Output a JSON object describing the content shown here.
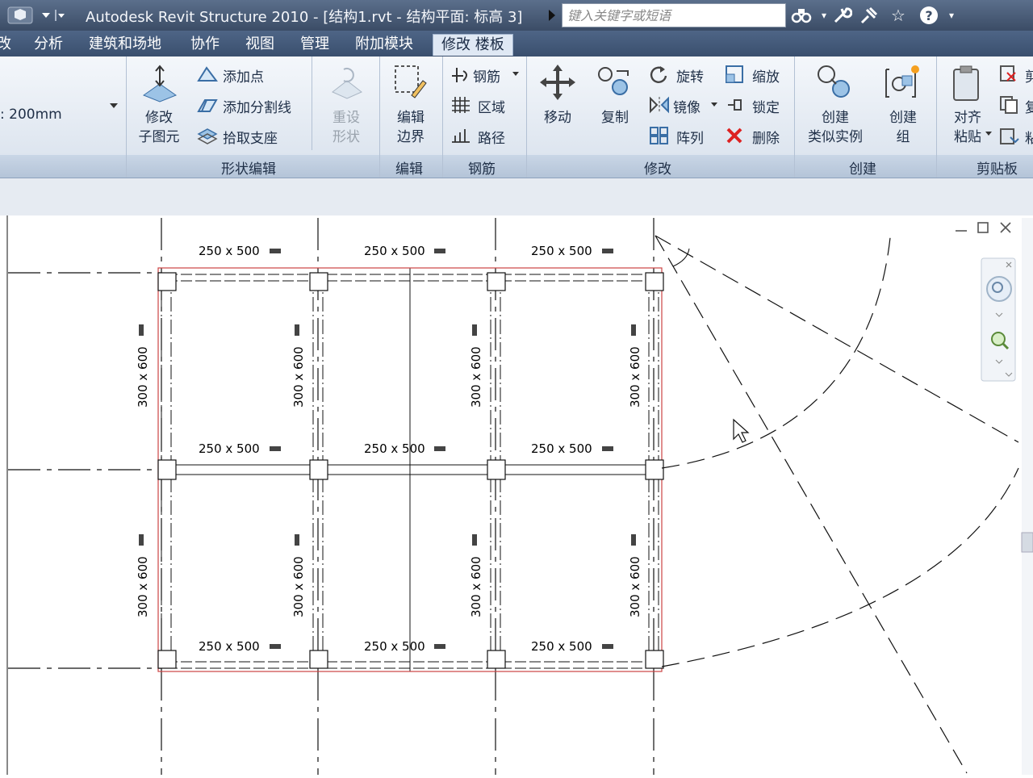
{
  "window": {
    "title": "Autodesk Revit Structure 2010 - [结构1.rvt - 结构平面: 标高 3]",
    "search_placeholder": "键入关键字或短语"
  },
  "tabs": [
    {
      "label": "改"
    },
    {
      "label": "分析"
    },
    {
      "label": "建筑和场地"
    },
    {
      "label": "协作"
    },
    {
      "label": "视图"
    },
    {
      "label": "管理"
    },
    {
      "label": "附加模块"
    },
    {
      "label": "修改 楼板",
      "active": true
    }
  ],
  "properties": {
    "value": "200mm"
  },
  "shape_edit": {
    "modify_sub": "修改\n子图元",
    "add_point": "添加点",
    "add_split_line": "添加分割线",
    "pick_support": "拾取支座",
    "reset_shape": "重设\n形状",
    "label": "形状编辑"
  },
  "edit": {
    "edit_boundary": "编辑\n边界",
    "label": "编辑"
  },
  "rebar": {
    "rebar": "钢筋",
    "area": "区域",
    "path": "路径",
    "label": "钢筋"
  },
  "modify": {
    "move": "移动",
    "copy": "复制",
    "rotate": "旋转",
    "mirror": "镜像",
    "array": "阵列",
    "scale": "缩放",
    "lock": "锁定",
    "delete": "删除",
    "label": "修改"
  },
  "create": {
    "similar": "创建\n类似实例",
    "group": "创建\n组",
    "label": "创建"
  },
  "clipboard": {
    "paste": "对齐\n粘贴",
    "cut": "剪",
    "copy": "复",
    "paste2": "粘",
    "label": "剪贴板"
  },
  "drawing": {
    "beam_label": "250 x 500",
    "column_label": "300 x 600"
  }
}
